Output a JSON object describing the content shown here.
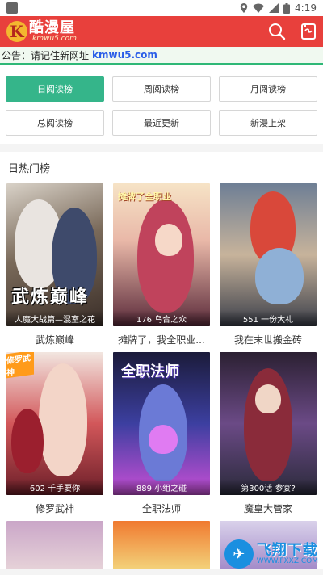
{
  "status": {
    "time": "4:19"
  },
  "app": {
    "name": "酷漫屋",
    "domain": "kmwu5.com",
    "logo_letter": "K"
  },
  "notice": {
    "text": "公告：请记住新网址",
    "site": "kmwu5.com"
  },
  "ranking": {
    "buttons": [
      {
        "label": "日阅读榜",
        "active": true
      },
      {
        "label": "周阅读榜",
        "active": false
      },
      {
        "label": "月阅读榜",
        "active": false
      },
      {
        "label": "总阅读榜",
        "active": false
      },
      {
        "label": "最近更新",
        "active": false
      },
      {
        "label": "新漫上架",
        "active": false
      }
    ]
  },
  "section": {
    "title": "日热门榜",
    "items": [
      {
        "title": "武炼巅峰",
        "caption": "人魔大战篇—混室之花",
        "cover_text": "武炼巅峰"
      },
      {
        "title": "摊牌了，我全职业...",
        "caption": "176 乌合之众",
        "cover_text": "摊牌了全职业"
      },
      {
        "title": "我在末世搬金砖",
        "caption": "551 一份大礼",
        "cover_text": ""
      },
      {
        "title": "修罗武神",
        "caption": "602 千手要你",
        "cover_text": "修罗武神"
      },
      {
        "title": "全职法师",
        "caption": "889 小组之碰",
        "cover_text": "全职法师"
      },
      {
        "title": "魔皇大管家",
        "caption": "第300话 参宴?",
        "cover_text": ""
      }
    ]
  },
  "watermark": {
    "name": "飞翔下载",
    "url": "WWW.FXXZ.COM"
  },
  "colors": {
    "header": "#e8403c",
    "accent": "#35b58a",
    "link": "#2a5ee8"
  }
}
